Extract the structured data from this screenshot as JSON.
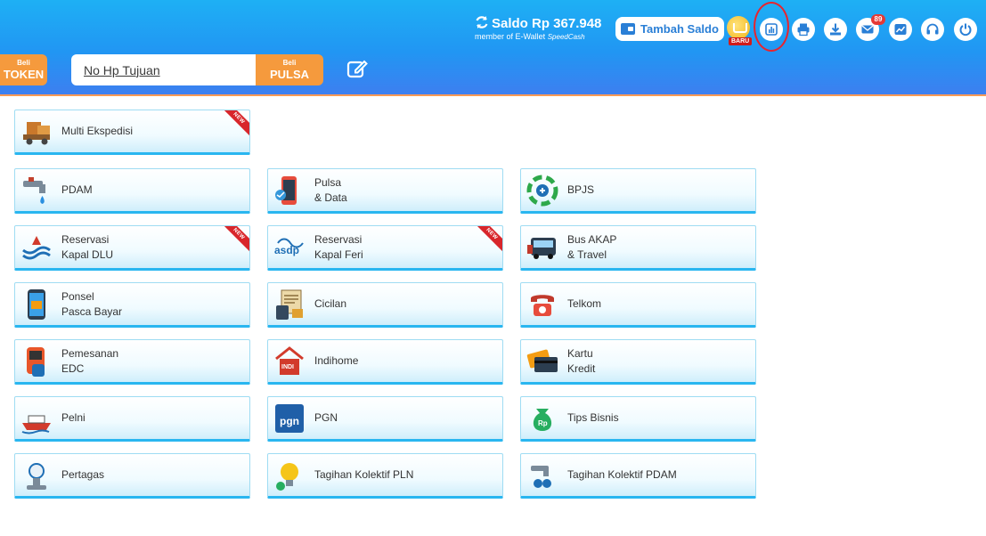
{
  "header": {
    "saldo_label": "Saldo Rp 367.948",
    "saldo_sub": "member of E-Wallet",
    "saldo_brand": "SpeedCash",
    "topup_label": "Tambah Saldo",
    "baru_badge": "BARU",
    "notification_count": "89",
    "icons": [
      "refresh-icon",
      "wallet-icon",
      "chart-icon",
      "print-icon",
      "download-icon",
      "mail-icon",
      "trend-icon",
      "headset-icon",
      "power-icon"
    ],
    "highlight_color": "#e8242e"
  },
  "purchase": {
    "token_small": "Beli",
    "token_big": "TOKEN",
    "phone_placeholder": "No Hp Tujuan",
    "pulsa_small": "Beli",
    "pulsa_big": "PULSA"
  },
  "colors": {
    "header_blue": "#2196f3",
    "accent_orange": "#f59a3d",
    "card_border": "#29b6f0"
  },
  "ribbon_text": "NEW",
  "services": [
    {
      "label": "Multi Ekspedisi",
      "icon": "delivery-truck-icon",
      "new": true
    },
    {
      "label": "PDAM",
      "icon": "water-tap-icon",
      "new": false
    },
    {
      "label": "Pulsa\n& Data",
      "icon": "phone-data-icon",
      "new": false
    },
    {
      "label": "BPJS",
      "icon": "bpjs-icon",
      "new": false
    },
    {
      "label": "Reservasi\nKapal DLU",
      "icon": "ship-wave-icon",
      "new": true
    },
    {
      "label": "Reservasi\nKapal Feri",
      "icon": "asdp-icon",
      "new": true
    },
    {
      "label": "Bus AKAP\n& Travel",
      "icon": "bus-icon",
      "new": false
    },
    {
      "label": "Ponsel\nPasca Bayar",
      "icon": "postpaid-phone-icon",
      "new": false
    },
    {
      "label": "Cicilan",
      "icon": "installment-icon",
      "new": false
    },
    {
      "label": "Telkom",
      "icon": "telephone-icon",
      "new": false
    },
    {
      "label": "Pemesanan\nEDC",
      "icon": "edc-machine-icon",
      "new": false
    },
    {
      "label": "Indihome",
      "icon": "indihome-icon",
      "new": false
    },
    {
      "label": "Kartu\nKredit",
      "icon": "credit-card-icon",
      "new": false
    },
    {
      "label": "Pelni",
      "icon": "pelni-ship-icon",
      "new": false
    },
    {
      "label": "PGN",
      "icon": "pgn-icon",
      "new": false
    },
    {
      "label": "Tips Bisnis",
      "icon": "money-bag-icon",
      "new": false
    },
    {
      "label": "Pertagas",
      "icon": "gas-meter-icon",
      "new": false
    },
    {
      "label": "Tagihan Kolektif PLN",
      "icon": "bulb-icon",
      "new": false
    },
    {
      "label": "Tagihan Kolektif PDAM",
      "icon": "water-collective-icon",
      "new": false
    }
  ]
}
